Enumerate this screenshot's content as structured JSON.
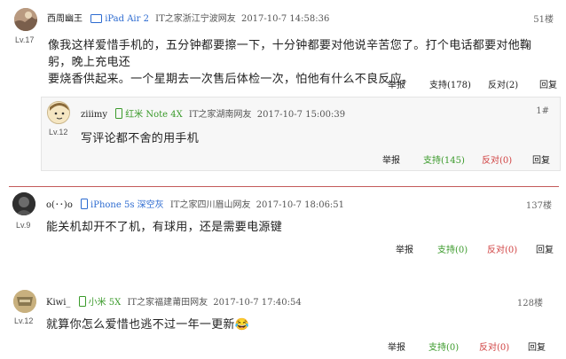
{
  "comments": [
    {
      "username": "西周幽王",
      "device": "iPad Air 2",
      "location": "IT之家浙江宁波网友",
      "time": "2017-10-7 14:58:36",
      "floor": "51楼",
      "level": "Lv.17",
      "content_lines": [
        "像我这样爱惜手机的，五分钟都要擦一下，十分钟都要对他说辛苦您了。打个电话都要对他鞠躬，晚上充电还",
        "要烧香供起来。一个星期去一次售后体检一次，怕他有什么不良反应。"
      ],
      "actions": {
        "report": "举报",
        "support": "支持(178)",
        "oppose": "反对(2)",
        "reply": "回复"
      },
      "reply": {
        "username": "ziiimy",
        "device": "红米 Note 4X",
        "location": "IT之家湖南网友",
        "time": "2017-10-7 15:00:39",
        "floor": "1#",
        "level": "Lv.12",
        "content": "写评论都不舍的用手机",
        "actions": {
          "report": "举报",
          "support": "支持(145)",
          "oppose": "反对(0)",
          "reply": "回复"
        }
      }
    },
    {
      "username": "o(･･)o",
      "device": "iPhone 5s 深空灰",
      "location": "IT之家四川眉山网友",
      "time": "2017-10-7 18:06:51",
      "floor": "137楼",
      "level": "Lv.9",
      "content": "能关机却开不了机，有球用，还是需要电源键",
      "actions": {
        "report": "举报",
        "support": "支持(0)",
        "oppose": "反对(0)",
        "reply": "回复"
      }
    },
    {
      "username": "Kiwi_",
      "device": "小米 5X",
      "location": "IT之家福建莆田网友",
      "time": "2017-10-7 17:40:54",
      "floor": "128楼",
      "level": "Lv.12",
      "content": "就算你怎么爱惜也逃不过一年一更新😂",
      "actions": {
        "report": "举报",
        "support": "支持(0)",
        "oppose": "反对(0)",
        "reply": "回复"
      }
    }
  ]
}
